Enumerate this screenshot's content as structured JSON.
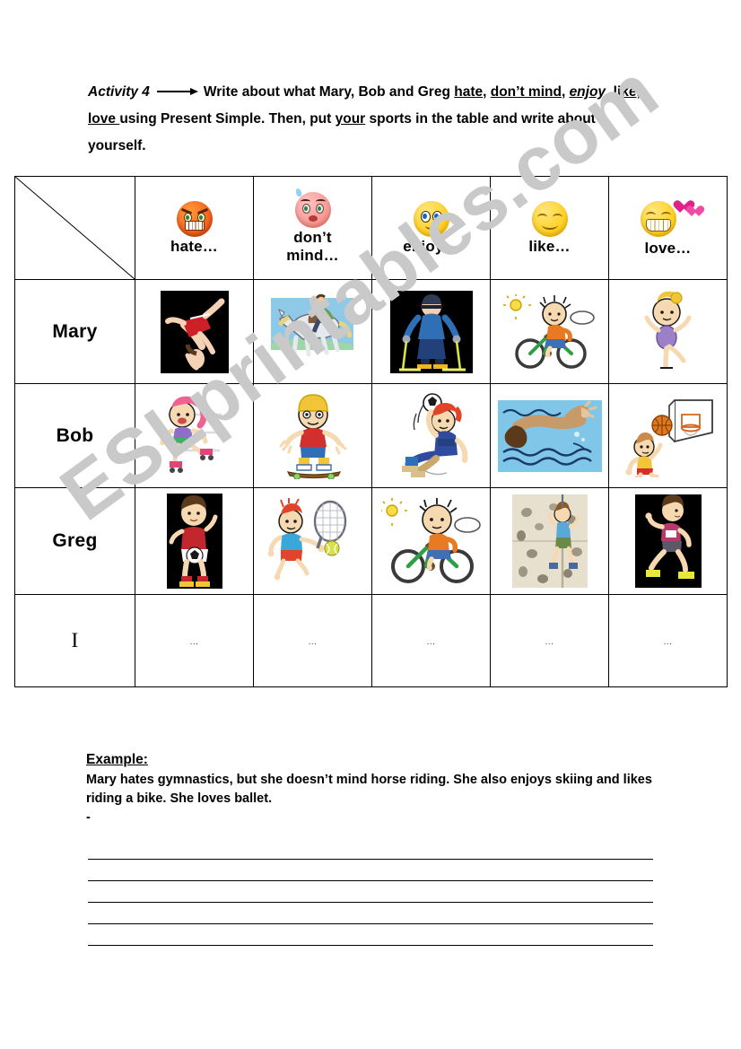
{
  "watermark": {
    "text": "ESLprintables.com"
  },
  "instructions": {
    "activity_label": "Activity 4",
    "part1": "Write about what Mary, Bob and Greg ",
    "w_hate": "hate",
    "sep1": ", ",
    "w_dont_mind": "don’t mind",
    "sep2": ", ",
    "w_enjoy": "enjoy",
    "sep3": ", ",
    "w_like": "like",
    "sep4": ", ",
    "w_love": "love ",
    "part2": "using Present Simple. Then, put ",
    "w_your": "your",
    "part3": " sports in the table and write about yourself."
  },
  "table": {
    "corner": {
      "label": ""
    },
    "columns": [
      {
        "key": "hate",
        "label": "hate…",
        "icon": "angry-face-icon",
        "color": "#f4641d"
      },
      {
        "key": "dont_mind",
        "label": "don’t\nmind…",
        "icon": "worried-face-icon",
        "color": "#f79a95"
      },
      {
        "key": "enjoy",
        "label": "enjoy…",
        "icon": "smiling-face-icon",
        "color": "#ffd32a"
      },
      {
        "key": "like",
        "label": "like…",
        "icon": "happy-face-icon",
        "color": "#ffd32a"
      },
      {
        "key": "love",
        "label": "love…",
        "icon": "love-face-icon",
        "color": "#ffd32a"
      }
    ],
    "rows": [
      {
        "name": "Mary",
        "cells": [
          {
            "sport": "gymnastics",
            "icon": "gymnastics-picture",
            "background": "black"
          },
          {
            "sport": "horse riding",
            "icon": "horse-riding-picture",
            "background": "white"
          },
          {
            "sport": "skiing",
            "icon": "skiing-picture",
            "background": "black"
          },
          {
            "sport": "cycling",
            "icon": "cycling-picture",
            "background": "white"
          },
          {
            "sport": "ballet",
            "icon": "ballet-picture",
            "background": "white"
          }
        ]
      },
      {
        "name": "Bob",
        "cells": [
          {
            "sport": "roller skating",
            "icon": "roller-skating-picture",
            "background": "white"
          },
          {
            "sport": "skateboarding",
            "icon": "skateboarding-picture",
            "background": "white"
          },
          {
            "sport": "football",
            "icon": "goalkeeper-picture",
            "background": "white"
          },
          {
            "sport": "swimming",
            "icon": "swimming-picture",
            "background": "blue"
          },
          {
            "sport": "basketball",
            "icon": "basketball-picture",
            "background": "white"
          }
        ]
      },
      {
        "name": "Greg",
        "cells": [
          {
            "sport": "football",
            "icon": "footballer-picture",
            "background": "black"
          },
          {
            "sport": "tennis",
            "icon": "tennis-picture",
            "background": "white"
          },
          {
            "sport": "cycling",
            "icon": "cycling-picture",
            "background": "white"
          },
          {
            "sport": "climbing",
            "icon": "climbing-picture",
            "background": "beige"
          },
          {
            "sport": "running",
            "icon": "running-picture",
            "background": "black"
          }
        ]
      },
      {
        "name": "I",
        "cells": [
          {
            "sport": "",
            "icon": "ellipsis",
            "placeholder": "..."
          },
          {
            "sport": "",
            "icon": "ellipsis",
            "placeholder": "..."
          },
          {
            "sport": "",
            "icon": "ellipsis",
            "placeholder": "..."
          },
          {
            "sport": "",
            "icon": "ellipsis",
            "placeholder": "..."
          },
          {
            "sport": "",
            "icon": "ellipsis",
            "placeholder": "..."
          }
        ]
      }
    ]
  },
  "example": {
    "title": "Example:",
    "text": "Mary  hates gymnastics, but she doesn’t mind horse riding. She also enjoys skiing and likes riding a bike. She loves ballet.",
    "dash": "-"
  },
  "writing_lines": {
    "count": 5
  }
}
